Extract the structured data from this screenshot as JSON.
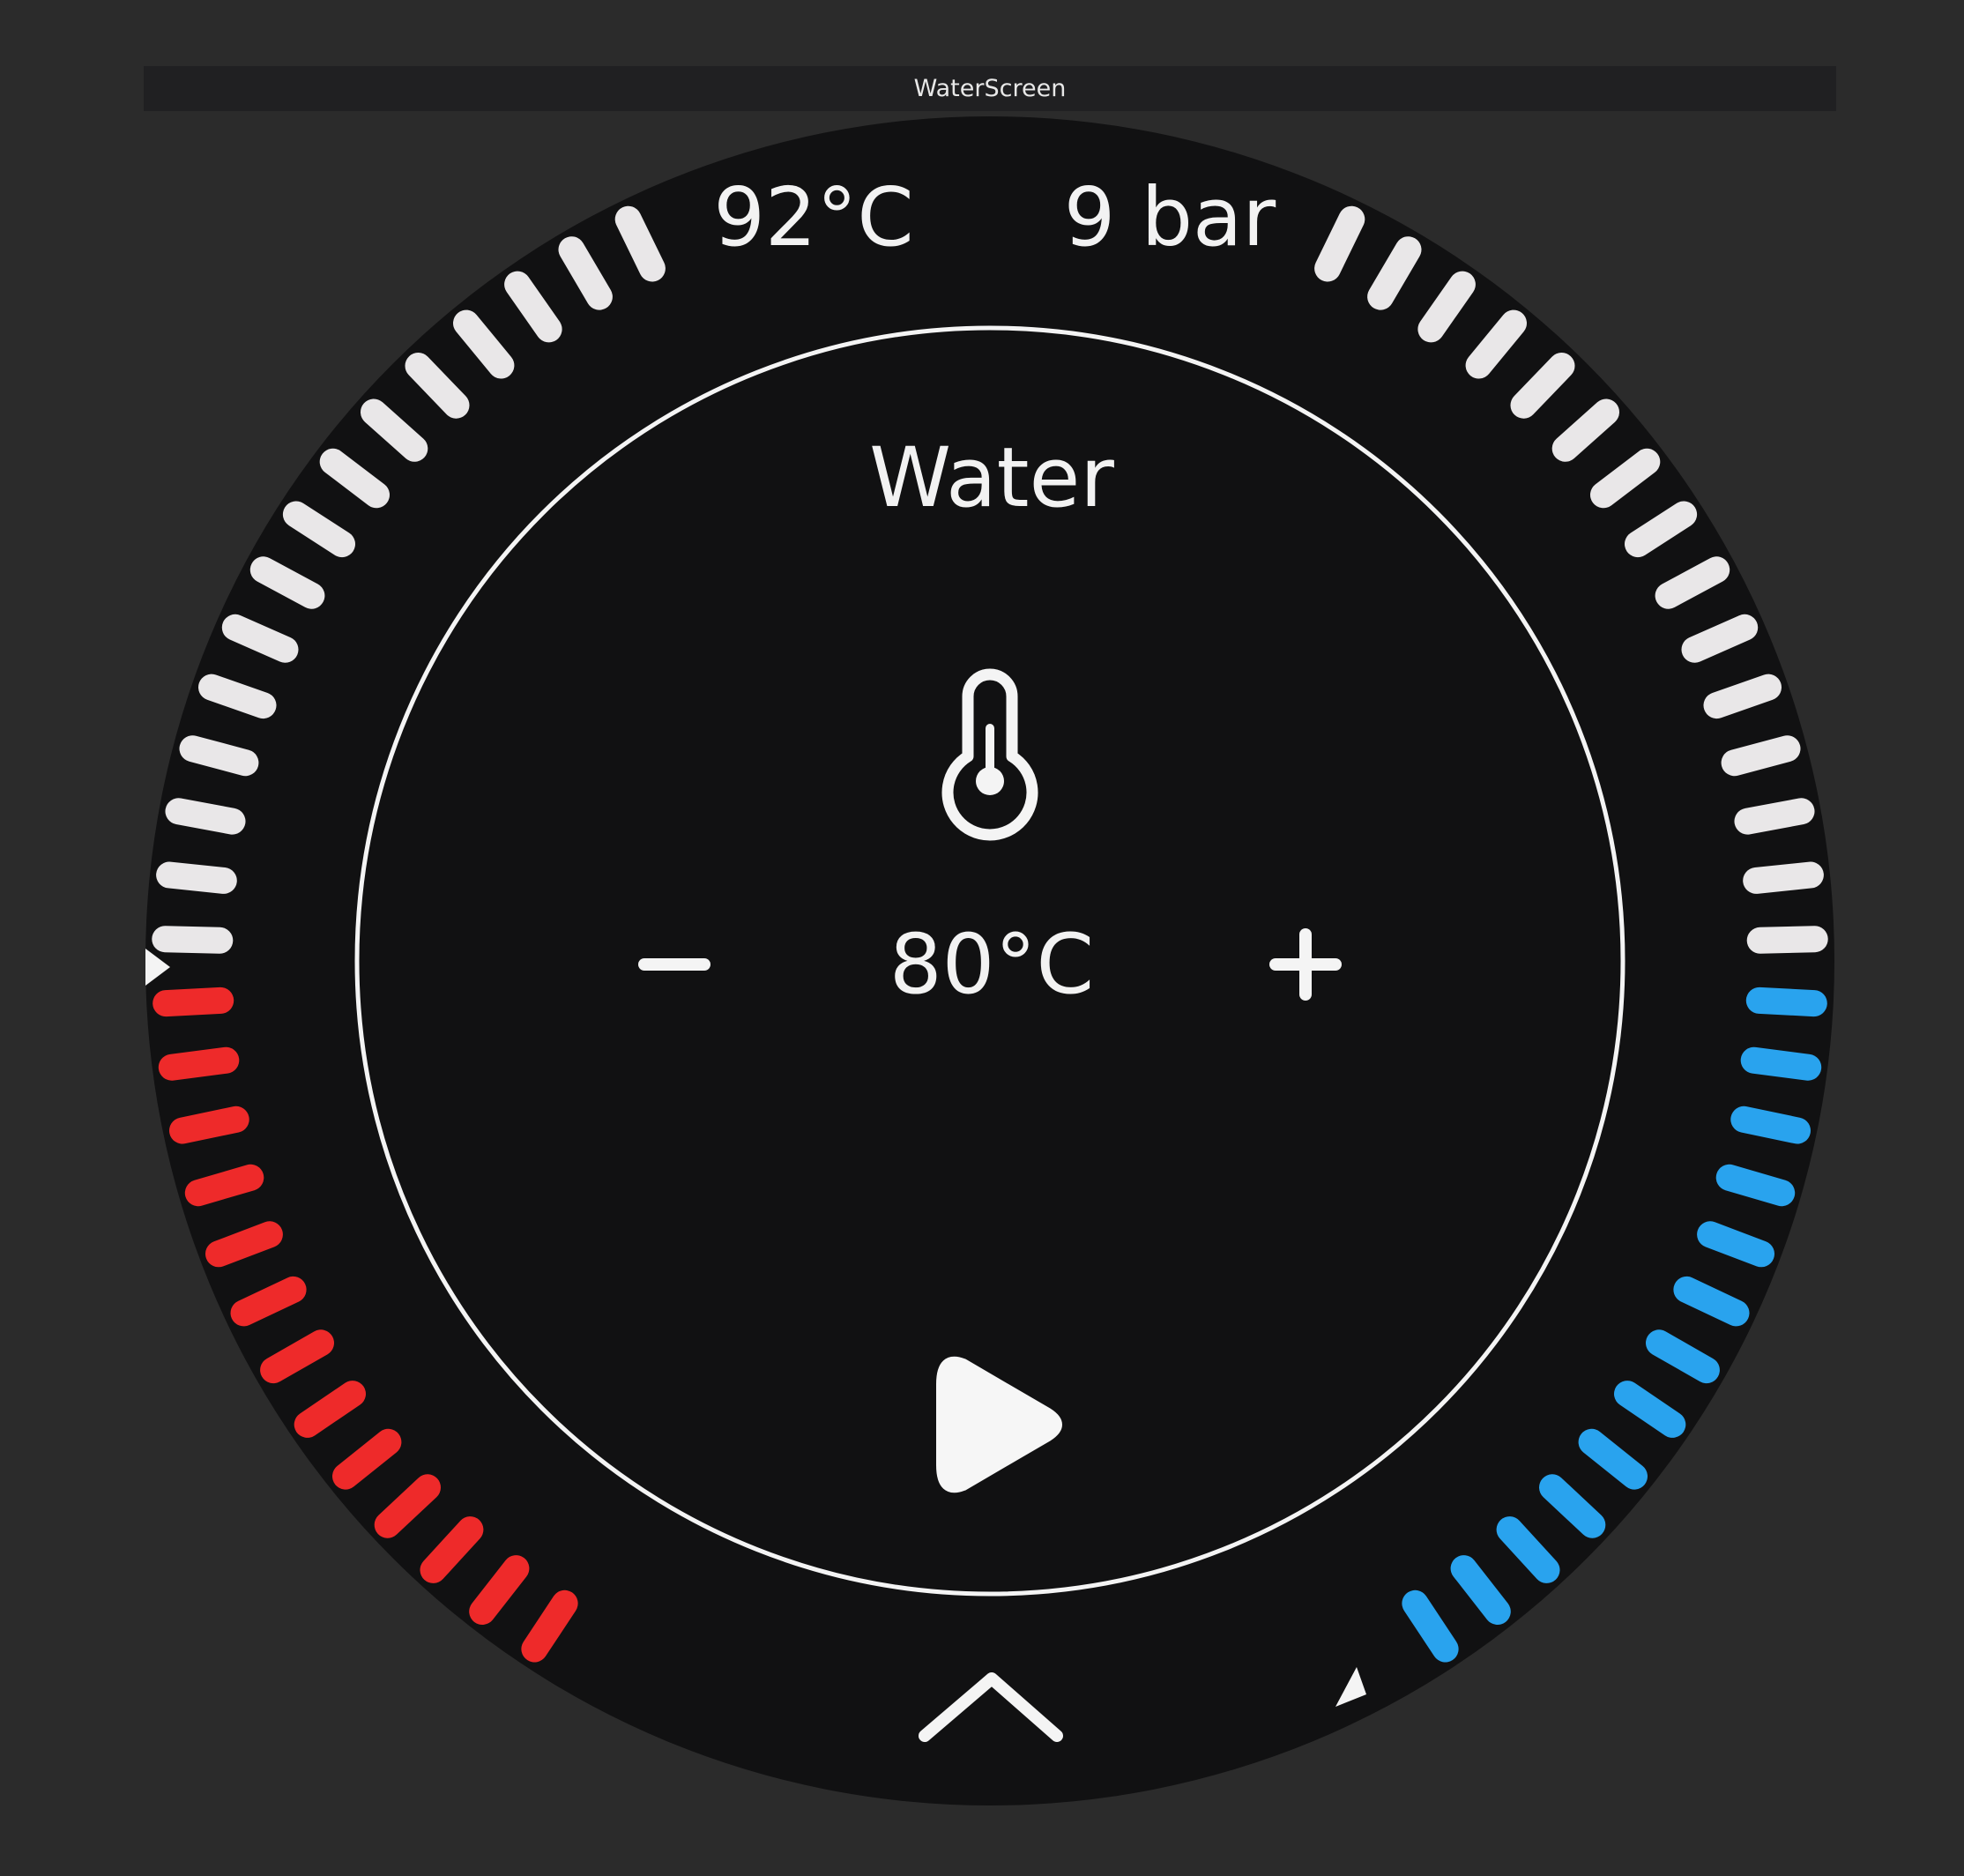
{
  "window": {
    "title": "WaterScreen"
  },
  "status": {
    "current_temperature": "92°C",
    "pressure": "9 bar"
  },
  "panel": {
    "title": "Water",
    "icon": "thermometer-icon",
    "target_temperature": "80°C",
    "decrease_label": "−",
    "increase_label": "+",
    "start_icon": "play-icon",
    "expand_icon": "chevron-up-icon"
  },
  "gauges": {
    "temperature": {
      "active_fraction": 0.48,
      "active_color": "#ee2a2a",
      "inactive_color": "#e9e7e8"
    },
    "pressure": {
      "active_fraction": 0.48,
      "active_color": "#29a3ee",
      "inactive_color": "#e9e7e8"
    }
  },
  "colors": {
    "background": "#2b2b2b",
    "dial": "#111112",
    "ring": "#f4f4f4",
    "text": "#f2f2f2"
  }
}
